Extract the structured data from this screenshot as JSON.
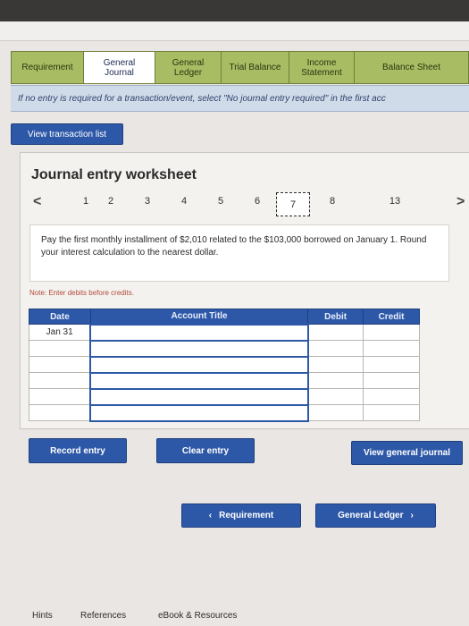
{
  "tabs": [
    {
      "label": "Requirement",
      "active": false
    },
    {
      "label": "General Journal",
      "active": true
    },
    {
      "label": "General Ledger",
      "active": false
    },
    {
      "label": "Trial Balance",
      "active": false
    },
    {
      "label": "Income Statement",
      "active": false
    },
    {
      "label": "Balance Sheet",
      "active": false
    }
  ],
  "info_text": "If no entry is required for a transaction/event, select \"No journal entry required\" in the first acc",
  "view_transaction_list": "View transaction list",
  "worksheet": {
    "title": "Journal entry worksheet",
    "nav_prev": "<",
    "nav_next": ">",
    "entries": [
      "1",
      "2",
      "3",
      "4",
      "5",
      "6",
      "7",
      "8",
      "13"
    ],
    "selected_entry": "7",
    "description": "Pay the first monthly installment of $2,010 related to the $103,000 borrowed on January 1. Round your interest calculation to the nearest dollar.",
    "note": "Note: Enter debits before credits."
  },
  "table": {
    "headers": {
      "date": "Date",
      "account": "Account Title",
      "debit": "Debit",
      "credit": "Credit"
    },
    "rows": [
      {
        "date": "Jan 31",
        "account": "",
        "debit": "",
        "credit": ""
      },
      {
        "date": "",
        "account": "",
        "debit": "",
        "credit": ""
      },
      {
        "date": "",
        "account": "",
        "debit": "",
        "credit": ""
      },
      {
        "date": "",
        "account": "",
        "debit": "",
        "credit": ""
      },
      {
        "date": "",
        "account": "",
        "debit": "",
        "credit": ""
      },
      {
        "date": "",
        "account": "",
        "debit": "",
        "credit": ""
      }
    ]
  },
  "buttons": {
    "record_entry": "Record entry",
    "clear_entry": "Clear entry",
    "view_general_journal": "View general journal",
    "requirement": "Requirement",
    "general_ledger": "General Ledger"
  },
  "footer": {
    "hints": "Hints",
    "references": "References",
    "ebook": "eBook & Resources"
  }
}
